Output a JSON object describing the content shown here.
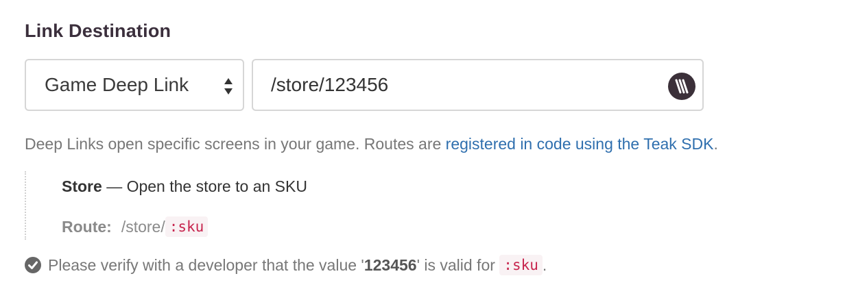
{
  "heading": "Link Destination",
  "destination_type": {
    "selected": "Game Deep Link",
    "icon": "select-arrows-icon"
  },
  "deep_link": {
    "value": "/store/123456",
    "icon": "vault-icon"
  },
  "help": {
    "text": "Deep Links open specific screens in your game. Routes are ",
    "link_text": "registered in code using the Teak SDK",
    "suffix": "."
  },
  "route": {
    "name": "Store",
    "separator": "—",
    "description": "Open the store to an SKU",
    "path_label": "Route:",
    "path_prefix": "/store/",
    "path_param": ":sku"
  },
  "verify": {
    "icon": "check-circle-icon",
    "text_before": "Please verify with a developer that the value '",
    "value": "123456",
    "text_middle": "' is valid for ",
    "param": ":sku",
    "text_after": "."
  },
  "colors": {
    "heading": "#3b2f3c",
    "link": "#2f6fae",
    "code_text": "#c7254e",
    "code_bg": "#f9f2f4",
    "icon_dark": "#3b3039"
  }
}
